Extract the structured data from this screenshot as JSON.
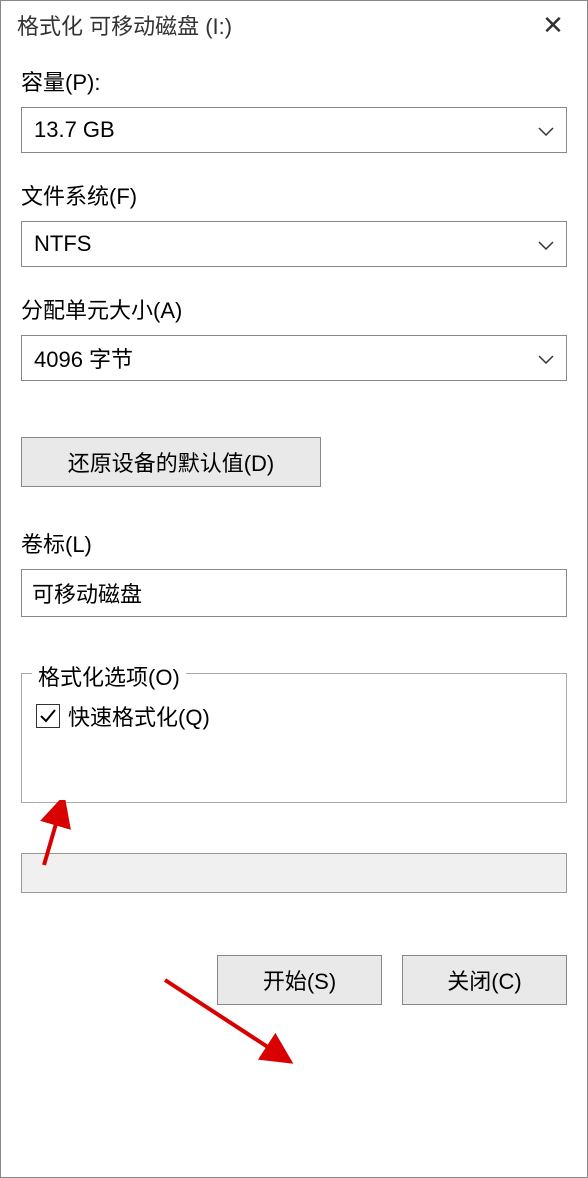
{
  "titlebar": {
    "title": "格式化 可移动磁盘 (I:)"
  },
  "capacity": {
    "label": "容量(P):",
    "value": "13.7 GB"
  },
  "filesystem": {
    "label": "文件系统(F)",
    "value": "NTFS"
  },
  "allocation": {
    "label": "分配单元大小(A)",
    "value": "4096 字节"
  },
  "restore_button": "还原设备的默认值(D)",
  "volume_label": {
    "label": "卷标(L)",
    "value": "可移动磁盘"
  },
  "format_options": {
    "legend": "格式化选项(O)",
    "quick_format": {
      "label": "快速格式化(Q)",
      "checked": true
    }
  },
  "buttons": {
    "start": "开始(S)",
    "close": "关闭(C)"
  }
}
